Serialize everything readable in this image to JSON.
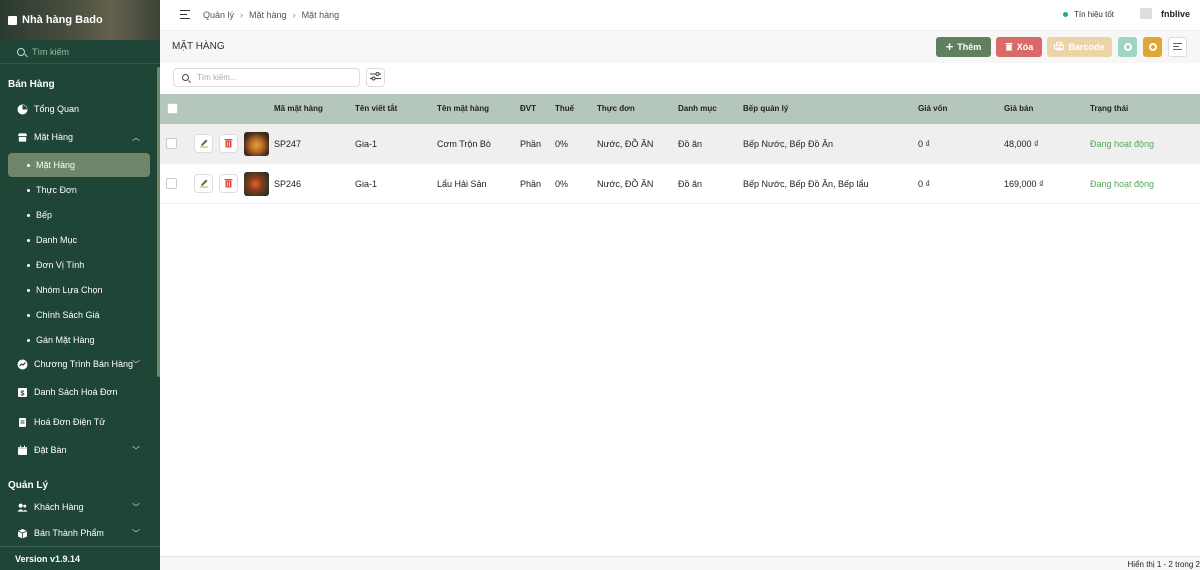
{
  "app": {
    "name": "Nhà hàng Bado",
    "search_placeholder": "Tìm kiếm",
    "version": "Version v1.9.14"
  },
  "sidebar": {
    "section_sales": "Bán Hàng",
    "section_manage": "Quản Lý",
    "items": {
      "overview": "Tổng Quan",
      "items": "Mặt Hàng",
      "programs": "Chương Trình Bán Hàng",
      "invoices": "Danh Sách Hoá Đơn",
      "einvoice": "Hoá Đơn Điện Tử",
      "booking": "Đặt Bàn",
      "customers": "Khách Hàng",
      "semi": "Bán Thành Phẩm"
    },
    "subitems": [
      "Mặt Hàng",
      "Thực Đơn",
      "Bếp",
      "Danh Mục",
      "Đơn Vị Tính",
      "Nhóm Lựa Chọn",
      "Chính Sách Giá",
      "Gán Mặt Hàng"
    ]
  },
  "topbar": {
    "breadcrumb": [
      "Quản lý",
      "Mặt hàng",
      "Mặt hàng"
    ],
    "signal": "Tín hiệu tốt",
    "user": "fnblive"
  },
  "toolbar": {
    "title": "MẶT HÀNG",
    "add": "Thêm",
    "delete": "Xóa",
    "barcode": "Barcode"
  },
  "filter": {
    "search_placeholder": "Tìm kiếm...",
    "search_value": ""
  },
  "table": {
    "columns": {
      "code": "Mã mặt hàng",
      "short": "Tên viết tắt",
      "name": "Tên mặt hàng",
      "unit": "ĐVT",
      "tax": "Thuế",
      "menu": "Thực đơn",
      "category": "Danh mục",
      "kitchen": "Bếp quản lý",
      "cost": "Giá vốn",
      "price": "Giá bán",
      "status": "Trạng thái"
    },
    "rows": [
      {
        "code": "SP247",
        "short": "Gia-1",
        "name": "Cơm Trộn Bò",
        "unit": "Phần",
        "tax": "0%",
        "menu": "Nước, ĐỒ ĂN",
        "category": "Đồ ăn",
        "kitchen": "Bếp Nước, Bếp Đồ Ăn",
        "cost": "0 ₫",
        "price": "48,000 ₫",
        "status": "Đang hoạt động"
      },
      {
        "code": "SP246",
        "short": "Gia-1",
        "name": "Lẩu Hải Sản",
        "unit": "Phần",
        "tax": "0%",
        "menu": "Nước, ĐỒ ĂN",
        "category": "Đồ ăn",
        "kitchen": "Bếp Nước, Bếp Đồ Ăn, Bếp lẩu",
        "cost": "0 ₫",
        "price": "169,000 ₫",
        "status": "Đang hoạt động"
      }
    ]
  },
  "footer": {
    "pagination": "Hiển thị 1 - 2 trong 2"
  },
  "colors": {
    "sidebar_bg": "#1f4536",
    "active_item": "#6f866b",
    "add_button": "#5f7f5f",
    "delete_button": "#d96a6a",
    "barcode_button": "#edd3a8",
    "table_header": "#b5c6bc",
    "status_active": "#55a85b",
    "signal_good": "#27ae60"
  }
}
